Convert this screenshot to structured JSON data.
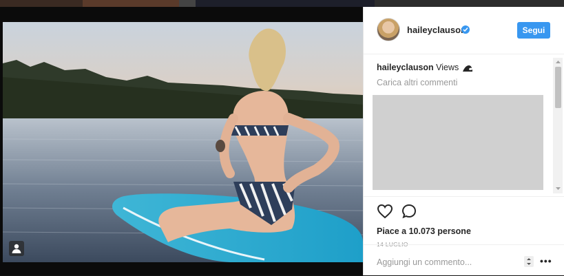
{
  "post": {
    "username": "haileyclauson",
    "follow_label": "Segui",
    "caption_user": "haileyclauson",
    "caption_text": "Views",
    "load_more": "Carica altri commenti",
    "likes": "Piace a 10.073 persone",
    "date": "14 LUGLIO",
    "comment_placeholder": "Aggiungi un commento...",
    "more_label": "•••"
  },
  "colors": {
    "accent": "#3897f0",
    "text": "#262626",
    "muted": "#999999"
  },
  "icons": [
    "verified-badge-icon",
    "wave-icon",
    "heart-icon",
    "comment-icon",
    "more-options-icon",
    "photo-tag-icon"
  ]
}
